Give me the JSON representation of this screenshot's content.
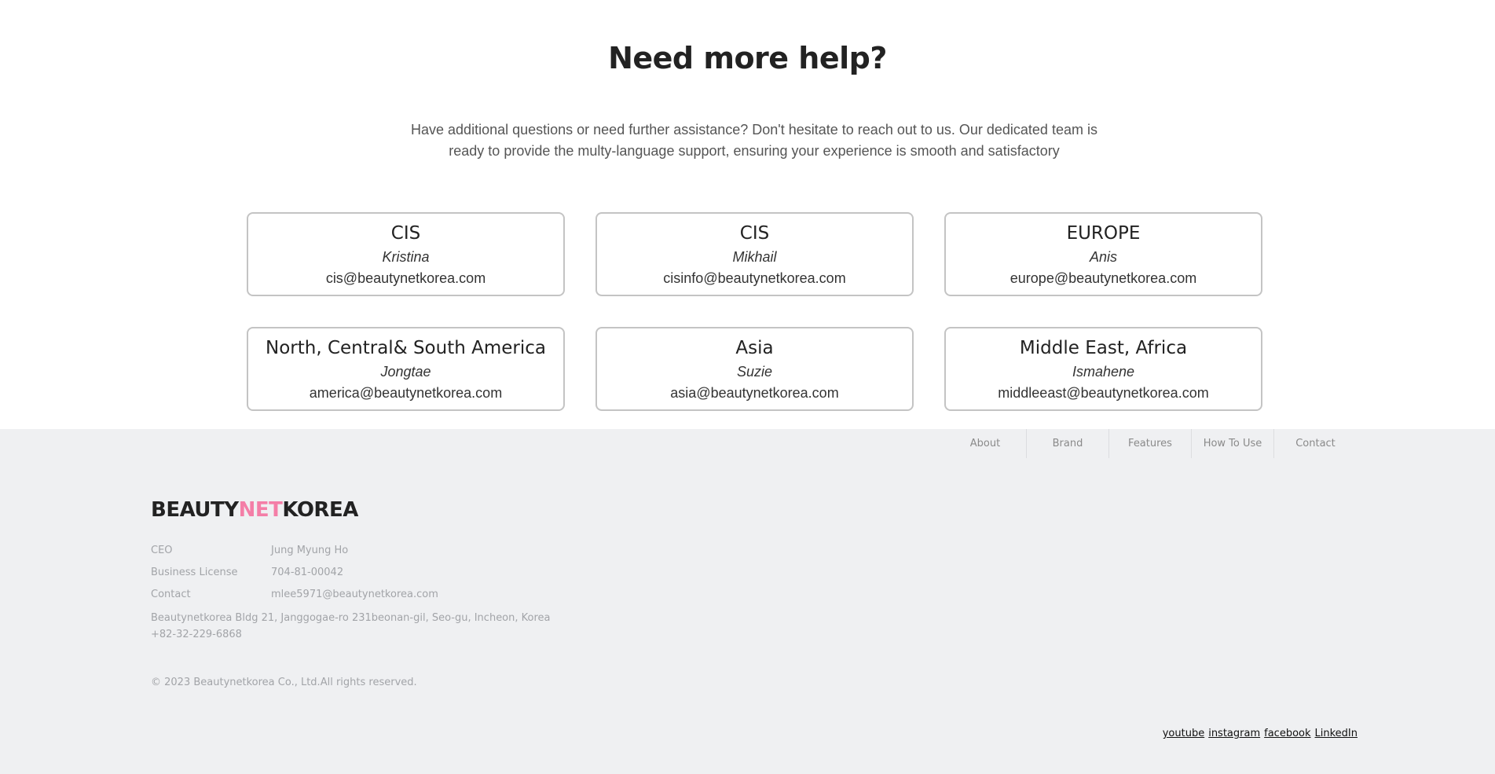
{
  "help": {
    "title": "Need more help?",
    "description": "Have additional questions or need further assistance? Don't hesitate to reach out to us. Our dedicated team is ready to provide the multy-language support, ensuring your experience is smooth and satisfactory"
  },
  "contacts": [
    {
      "region": "CIS",
      "name": "Kristina",
      "email": "cis@beautynetkorea.com"
    },
    {
      "region": "CIS",
      "name": "Mikhail",
      "email": "cisinfo@beautynetkorea.com"
    },
    {
      "region": "EUROPE",
      "name": "Anis",
      "email": "europe@beautynetkorea.com"
    },
    {
      "region": "North, Central& South America",
      "name": "Jongtae",
      "email": "america@beautynetkorea.com"
    },
    {
      "region": "Asia",
      "name": "Suzie",
      "email": "asia@beautynetkorea.com"
    },
    {
      "region": "Middle East, Africa",
      "name": "Ismahene",
      "email": "middleeast@beautynetkorea.com"
    }
  ],
  "footer": {
    "nav": [
      "About",
      "Brand",
      "Features",
      "How To Use",
      "Contact"
    ],
    "logo": {
      "part1": "BEAUTY",
      "part2": "NET",
      "part3": "KOREA",
      "accent_color": "#f47ea7"
    },
    "info": [
      {
        "label": "CEO",
        "value": "Jung Myung Ho"
      },
      {
        "label": "Business License",
        "value": "704-81-00042"
      },
      {
        "label": "Contact",
        "value": "mlee5971@beautynetkorea.com"
      }
    ],
    "address": "Beautynetkorea Bldg 21, Janggogae-ro 231beonan-gil, Seo-gu, Incheon, Korea",
    "phone": "+82-32-229-6868",
    "copyright": "© 2023 Beautynetkorea Co., Ltd.All rights reserved.",
    "social": [
      "youtube",
      "instagram",
      "facebook",
      "LinkedIn"
    ]
  }
}
